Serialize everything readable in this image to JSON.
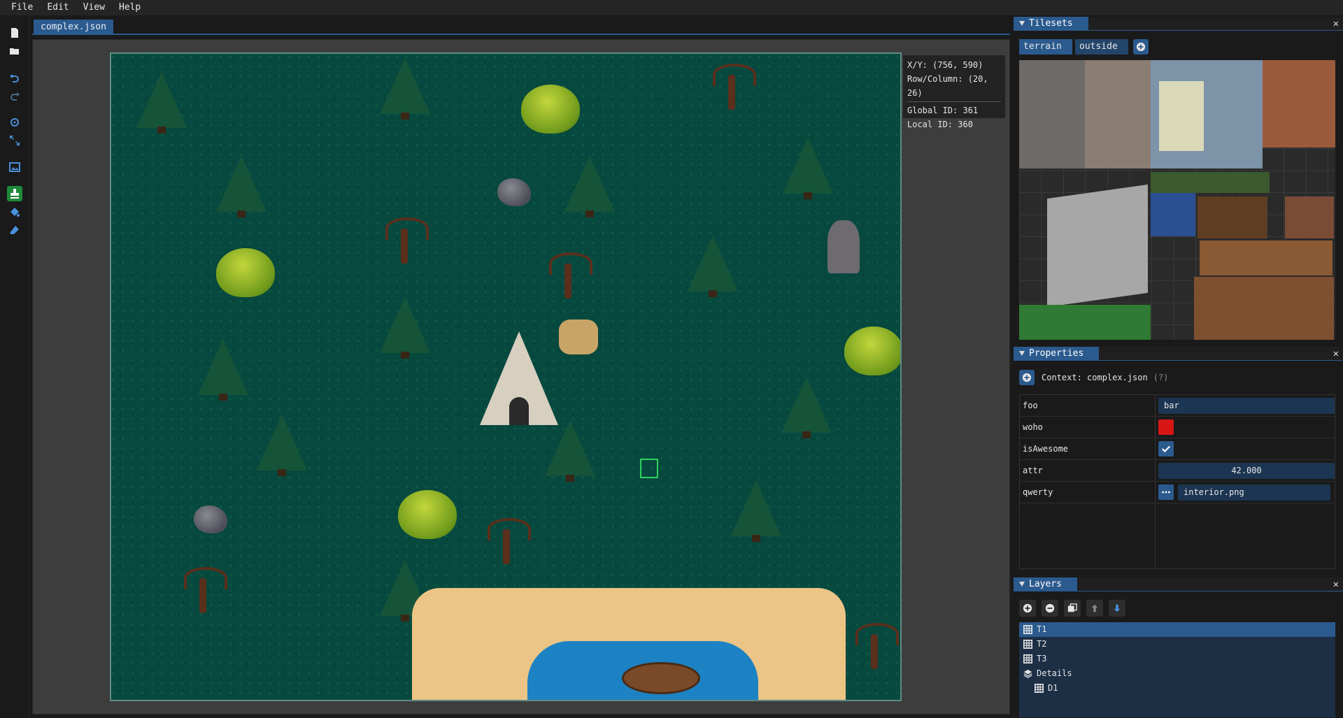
{
  "menu": [
    "File",
    "Edit",
    "View",
    "Help"
  ],
  "document_tab": "complex.json",
  "hover_info": {
    "xy": "X/Y: (756, 590)",
    "rowcol": "Row/Column: (20, 26)",
    "global_id": "Global ID: 361",
    "local_id": "Local ID: 360"
  },
  "tilesets_panel": {
    "title": "Tilesets",
    "tabs": [
      "terrain",
      "outside"
    ]
  },
  "properties_panel": {
    "title": "Properties",
    "context": "Context: complex.json",
    "help": "(?)",
    "rows": [
      {
        "name": "foo",
        "value": "bar"
      },
      {
        "name": "woho",
        "color": "#d81515"
      },
      {
        "name": "isAwesome",
        "checked": true
      },
      {
        "name": "attr",
        "value": "42.000"
      },
      {
        "name": "qwerty",
        "value": "interior.png"
      }
    ]
  },
  "layers_panel": {
    "title": "Layers",
    "layers": [
      {
        "name": "T1",
        "selected": true
      },
      {
        "name": "T2"
      },
      {
        "name": "T3"
      },
      {
        "name": "Details"
      },
      {
        "name": "D1"
      }
    ]
  },
  "colors": {
    "accent": "#2b5a8e",
    "active_tool": "#1f8a3a",
    "grass": "#07493e",
    "selection": "#2fd05a"
  }
}
